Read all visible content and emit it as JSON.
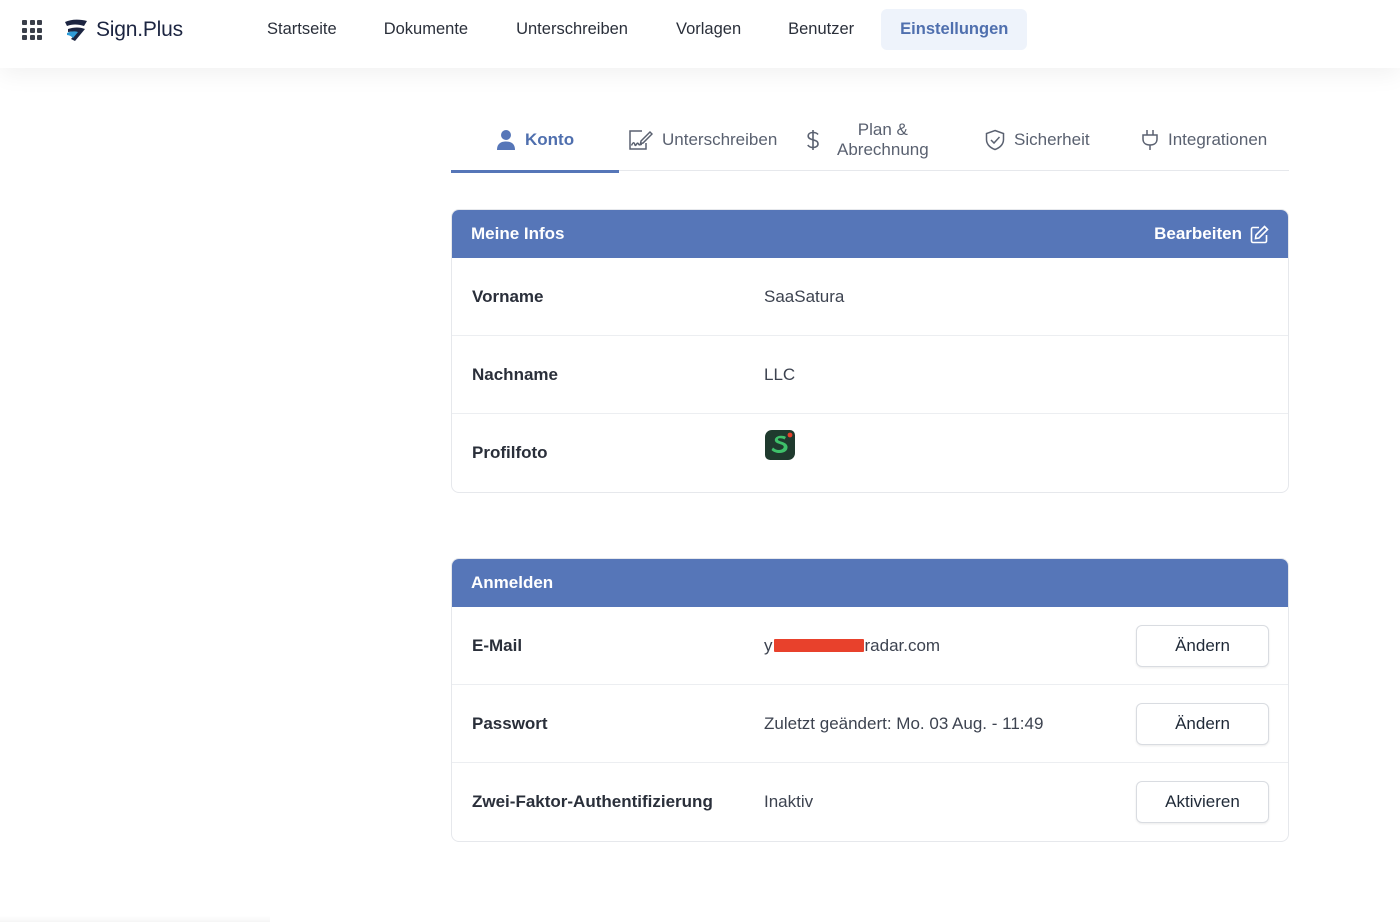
{
  "header": {
    "brand": "Sign.Plus",
    "nav": [
      {
        "label": "Startseite"
      },
      {
        "label": "Dokumente"
      },
      {
        "label": "Unterschreiben"
      },
      {
        "label": "Vorlagen"
      },
      {
        "label": "Benutzer"
      },
      {
        "label": "Einstellungen",
        "active": true
      }
    ]
  },
  "tabs": [
    {
      "label": "Konto",
      "icon": "user-icon",
      "active": true
    },
    {
      "label": "Unterschreiben",
      "icon": "sign-document-icon"
    },
    {
      "label_line1": "Plan &",
      "label_line2": "Abrechnung",
      "icon": "dollar-icon"
    },
    {
      "label": "Sicherheit",
      "icon": "shield-check-icon"
    },
    {
      "label": "Integrationen",
      "icon": "plug-icon"
    }
  ],
  "info_card": {
    "title": "Meine Infos",
    "edit_label": "Bearbeiten",
    "rows": [
      {
        "label": "Vorname",
        "value": "SaaSatura"
      },
      {
        "label": "Nachname",
        "value": "LLC"
      },
      {
        "label": "Profilfoto",
        "value": ""
      }
    ]
  },
  "login_card": {
    "title": "Anmelden",
    "rows": [
      {
        "label": "E-Mail",
        "value_prefix": "y",
        "value_suffix": "radar.com",
        "button": "Ändern"
      },
      {
        "label": "Passwort",
        "value": "Zuletzt geändert: Mo. 03 Aug. - 11:49",
        "button": "Ändern"
      },
      {
        "label": "Zwei-Faktor-Authentifizierung",
        "value": "Inaktiv",
        "button": "Aktivieren"
      }
    ]
  },
  "colors": {
    "accent": "#5676b8",
    "accent_text": "#4f6fae",
    "nav_active_bg": "#eef3fb",
    "redaction": "#e8412c"
  }
}
